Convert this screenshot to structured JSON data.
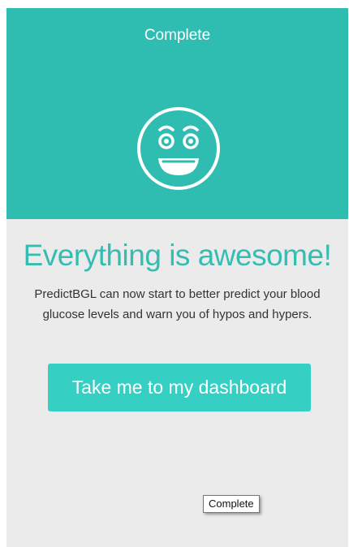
{
  "header": {
    "title": "Complete",
    "icon": "smiling-face-icon",
    "background_color": "#30bdb1"
  },
  "main": {
    "headline": "Everything is awesome!",
    "message": "PredictBGL can now start to better predict your blood glucose levels and warn you of hypos and hypers.",
    "cta_label": "Take me to my dashboard",
    "headline_color": "#35bdb2",
    "cta_color": "#35cfc3",
    "background_color": "#ebebeb"
  },
  "tooltip": {
    "text": "Complete"
  }
}
